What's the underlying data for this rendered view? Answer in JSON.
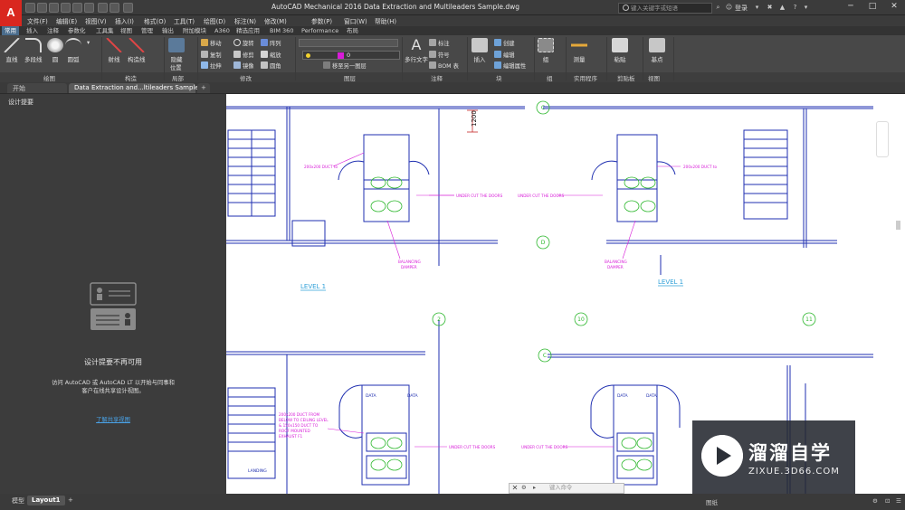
{
  "app": {
    "logo_letter": "A",
    "window_title": "AutoCAD Mechanical 2016     Data Extraction and Multileaders Sample.dwg",
    "search_placeholder": "键入关键字或短语",
    "login_label": "登录",
    "minimize": "─",
    "maximize": "□",
    "close": "✕"
  },
  "menubar": {
    "items": [
      "文件(F)",
      "编辑(E)",
      "视图(V)",
      "插入(I)",
      "格式(O)",
      "工具(T)",
      "绘图(D)",
      "标注(N)",
      "修改(M)",
      "参数(P)",
      "窗口(W)",
      "帮助(H)"
    ]
  },
  "ribbon_tabs": [
    "常用",
    "插入",
    "注释",
    "参数化",
    "工具集",
    "视图",
    "管理",
    "输出",
    "附加模块",
    "A360",
    "精选应用",
    "BIM 360",
    "Performance",
    "布局"
  ],
  "ribbon": {
    "draw": {
      "line": "直线",
      "polyline": "多段线",
      "circle": "圆",
      "arc": "圆弧"
    },
    "modify_small": [
      "移动",
      "旋转",
      "修剪",
      "复制",
      "镜像",
      "圆角",
      "拉伸",
      "缩放",
      "阵列"
    ],
    "layers": {
      "layer_name": "0",
      "move_to_layer": "移至另一图层"
    },
    "annotation": {
      "mtext": "多行文字",
      "dimension": "标注",
      "symbol": "符号",
      "bom": "BOM 表"
    },
    "block": {
      "insert": "插入",
      "create": "创建",
      "edit": "编辑",
      "edit_attr": "编辑属性"
    },
    "groups": {
      "group": "组"
    },
    "utilities": {
      "measure": "测量"
    },
    "clipboard": {
      "paste": "粘贴"
    },
    "view": {
      "base": "基点"
    },
    "extra_tools": [
      "射线",
      "构造线",
      "隐藏",
      "位置"
    ],
    "panel_labels": [
      "绘图",
      "构造",
      "局部",
      "修改",
      "图层",
      "注释",
      "块",
      "组",
      "实用程序",
      "剪贴板",
      "视图"
    ]
  },
  "doc_tabs": {
    "start": "开始",
    "active": "Data Extraction and...ltileaders Sample*",
    "add": "+"
  },
  "palette": {
    "title": "设计提要",
    "heading": "设计提要不再可用",
    "description": "访问 AutoCAD 或 AutoCAD LT 以开始与同事和客户在线共享设计视图。",
    "link": "了解共享视图"
  },
  "drawing": {
    "dim_value": "1200",
    "duct_label_1": "200x200 DUCT to",
    "duct_label_2": "200x200 DUCT to",
    "under_cut": "UNDER CUT THE DOORS",
    "balancing": "BALANCING",
    "damper": "DAMPER",
    "level": "LEVEL 1",
    "grid_c": "C",
    "grid_d": "D",
    "grid_2": "2",
    "grid_10": "10",
    "grid_11": "11",
    "data_room": "DATA",
    "landing": "LANDING",
    "duct_from": [
      "200x200 DUCT FROM",
      "BELOW TO CEILING LEVEL",
      "& 150x150 DUCT TO",
      "ROOF MOUNTED",
      "EXHAUST F1"
    ]
  },
  "layout_tabs": {
    "model": "模型",
    "layout1": "Layout1",
    "add": "+"
  },
  "command_line": {
    "placeholder": "键入命令"
  },
  "status": {
    "model": "图纸",
    "items": [
      "▦",
      "⊙",
      "∠",
      "⊡",
      "◎",
      "⚙",
      "⊕",
      "☰"
    ]
  },
  "watermark": {
    "title": "溜溜自学",
    "url": "ZIXUE.3D66.COM"
  },
  "colors": {
    "accent": "#4a6c8c",
    "magenta": "#d81bd8",
    "blue": "#1f2fb0",
    "green": "#2fb82f"
  }
}
